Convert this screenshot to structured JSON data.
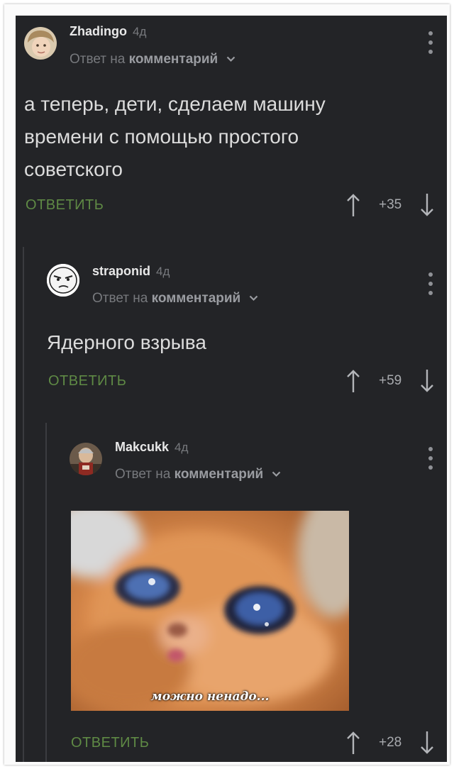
{
  "comments": [
    {
      "username": "Zhadingo",
      "age": "4д",
      "reply_prefix": "Ответ на",
      "reply_target": "комментарий",
      "text": "а теперь, дети, сделаем машину времени с помощью простого советского",
      "reply_label": "ОТВЕТИТЬ",
      "score": "+35"
    },
    {
      "username": "straponid",
      "age": "4д",
      "reply_prefix": "Ответ на",
      "reply_target": "комментарий",
      "text": "Ядерного взрыва",
      "reply_label": "ОТВЕТИТЬ",
      "score": "+59"
    },
    {
      "username": "Makcukk",
      "age": "4д",
      "reply_prefix": "Ответ на",
      "reply_target": "комментарий",
      "image_caption": "можно ненадо...",
      "reply_label": "ОТВЕТИТЬ",
      "score": "+28"
    }
  ],
  "colors": {
    "background": "#232427",
    "reply_button": "#5f8a45",
    "text": "#dcdcdc",
    "muted": "#77797d"
  },
  "icons": [
    "chevron-down-icon",
    "more-vertical-icon",
    "upvote-arrow-icon",
    "downvote-arrow-icon"
  ]
}
